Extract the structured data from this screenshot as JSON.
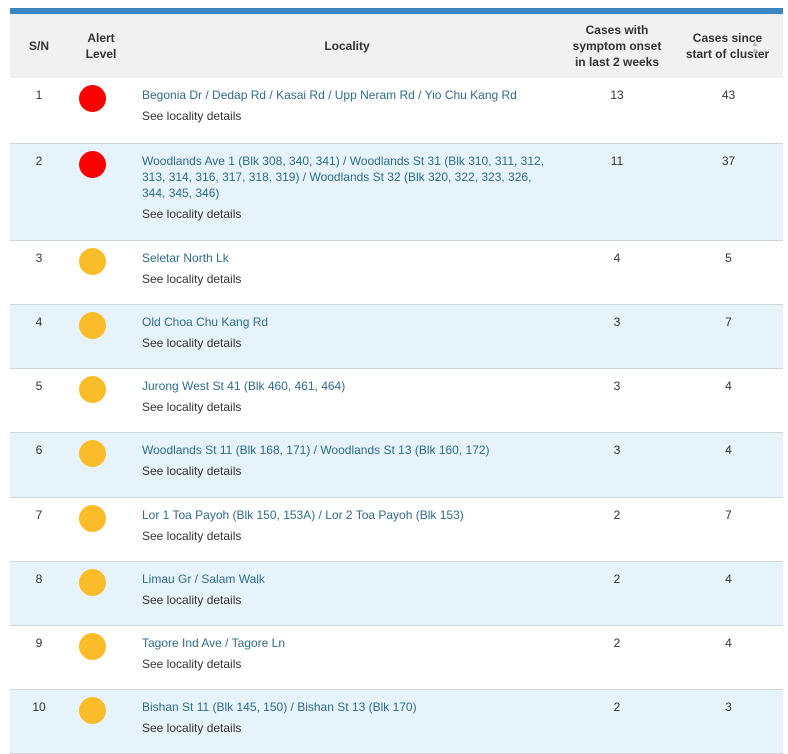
{
  "headers": {
    "sn": "S/N",
    "alert": "Alert Level",
    "locality": "Locality",
    "cases_2wk": "Cases with symptom onset in last 2 weeks",
    "cases_total": "Cases since start of cluster"
  },
  "colors": {
    "red": "#ff0000",
    "amber": "#fbbc2a",
    "header_bar": "#3a86c2",
    "link": "#2e6c8e"
  },
  "icons": {
    "sort": "sort-icon"
  },
  "rows": [
    {
      "sn": "1",
      "alert": "red",
      "locality": "Begonia Dr / Dedap Rd / Kasai Rd / Upp Neram Rd / Yio Chu Kang Rd",
      "details": "See locality details",
      "cases_2wk": "13",
      "cases_total": "43"
    },
    {
      "sn": "2",
      "alert": "red",
      "locality": "Woodlands Ave 1 (Blk 308, 340, 341) / Woodlands St 31 (Blk 310, 311, 312, 313, 314, 316, 317, 318, 319) / Woodlands St 32 (Blk 320, 322, 323, 326, 344, 345, 346)",
      "details": "See locality details",
      "cases_2wk": "11",
      "cases_total": "37"
    },
    {
      "sn": "3",
      "alert": "amber",
      "locality": "Seletar North Lk",
      "details": "See locality details",
      "cases_2wk": "4",
      "cases_total": "5"
    },
    {
      "sn": "4",
      "alert": "amber",
      "locality": "Old Choa Chu Kang Rd",
      "details": "See locality details",
      "cases_2wk": "3",
      "cases_total": "7"
    },
    {
      "sn": "5",
      "alert": "amber",
      "locality": "Jurong West St 41 (Blk 460, 461, 464)",
      "details": "See locality details",
      "cases_2wk": "3",
      "cases_total": "4"
    },
    {
      "sn": "6",
      "alert": "amber",
      "locality": "Woodlands St 11 (Blk 168, 171) / Woodlands St 13 (Blk 160, 172)",
      "details": "See locality details",
      "cases_2wk": "3",
      "cases_total": "4"
    },
    {
      "sn": "7",
      "alert": "amber",
      "locality": "Lor 1 Toa Payoh (Blk 150, 153A) / Lor 2 Toa Payoh (Blk 153)",
      "details": "See locality details",
      "cases_2wk": "2",
      "cases_total": "7"
    },
    {
      "sn": "8",
      "alert": "amber",
      "locality": "Limau Gr / Salam Walk",
      "details": "See locality details",
      "cases_2wk": "2",
      "cases_total": "4"
    },
    {
      "sn": "9",
      "alert": "amber",
      "locality": "Tagore Ind Ave / Tagore Ln",
      "details": "See locality details",
      "cases_2wk": "2",
      "cases_total": "4"
    },
    {
      "sn": "10",
      "alert": "amber",
      "locality": "Bishan St 11 (Blk 145, 150) / Bishan St 13 (Blk 170)",
      "details": "See locality details",
      "cases_2wk": "2",
      "cases_total": "3"
    }
  ]
}
